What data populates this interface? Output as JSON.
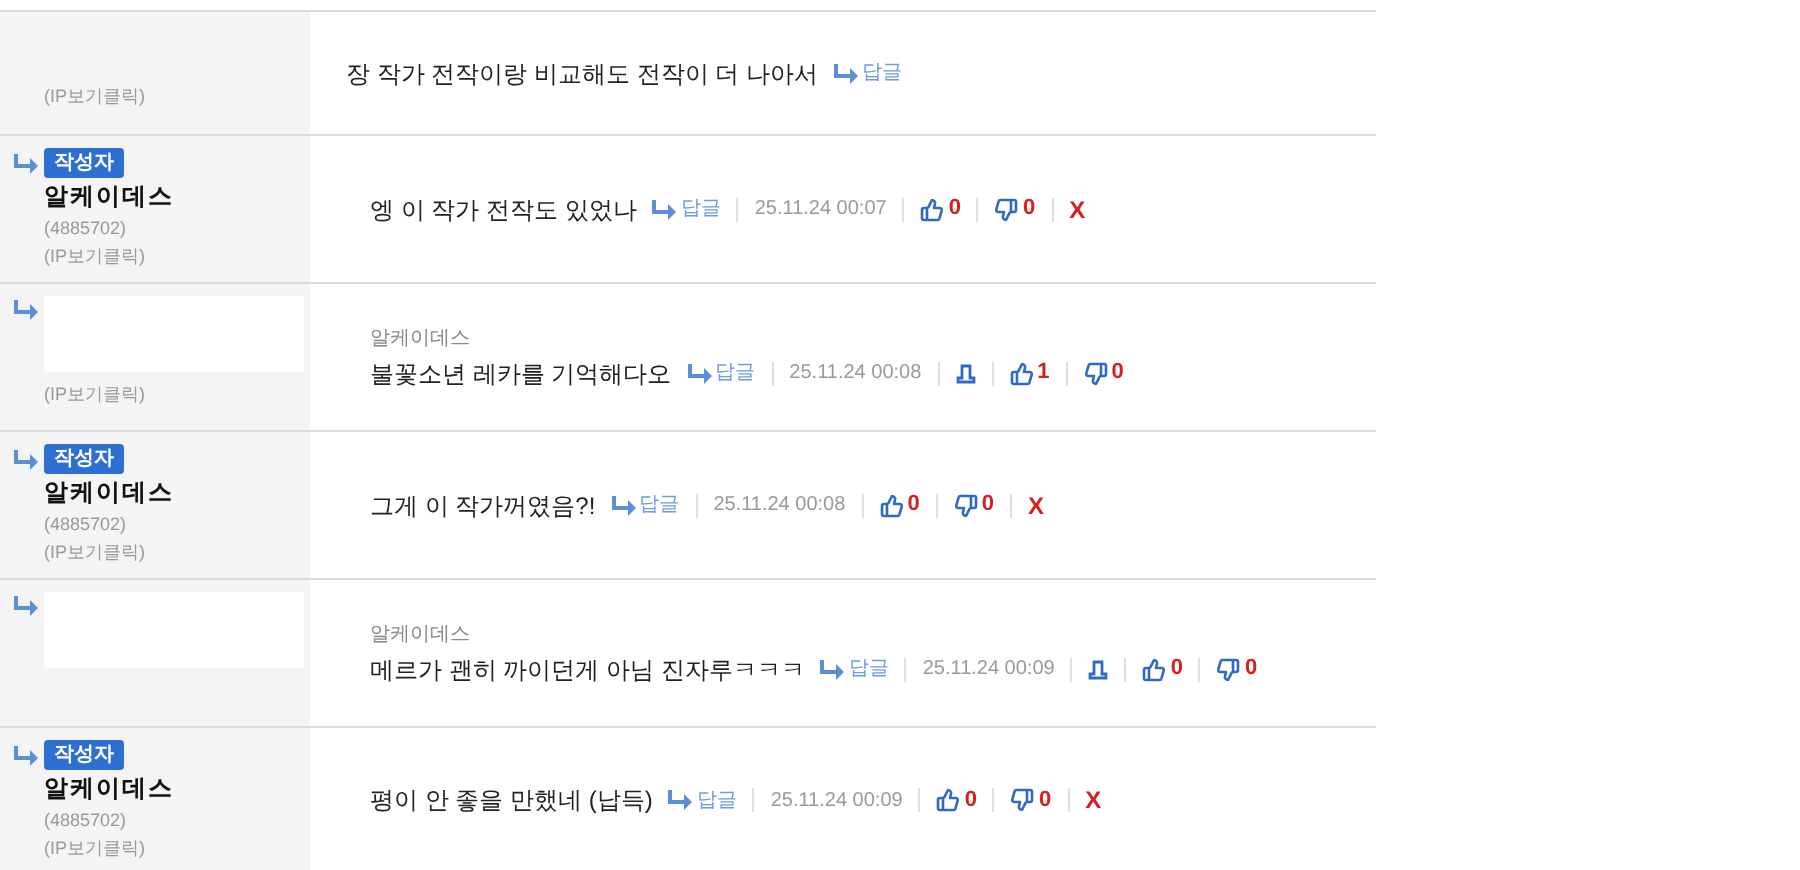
{
  "comments": [
    {
      "kind": "user",
      "ip": "(IP보기클릭)",
      "text": "장 작가 전작이랑 비교해도 전작이 더 나아서",
      "reply": "답글"
    },
    {
      "kind": "author",
      "badge": "작성자",
      "name": "알케이데스",
      "uid": "(4885702)",
      "ip": "(IP보기클릭)",
      "text": "엥 이 작가 전작도 있었나",
      "reply": "답글",
      "date": "25.11.24 00:07",
      "likes": "0",
      "dislikes": "0",
      "delete": "X"
    },
    {
      "kind": "user",
      "ip": "(IP보기클릭)",
      "target": "알케이데스",
      "text": "불꽃소년 레카를 기억해다오",
      "reply": "답글",
      "date": "25.11.24 00:08",
      "report": true,
      "likes": "1",
      "dislikes": "0"
    },
    {
      "kind": "author",
      "badge": "작성자",
      "name": "알케이데스",
      "uid": "(4885702)",
      "ip": "(IP보기클릭)",
      "text": "그게 이 작가꺼였음?!",
      "reply": "답글",
      "date": "25.11.24 00:08",
      "likes": "0",
      "dislikes": "0",
      "delete": "X"
    },
    {
      "kind": "user",
      "target": "알케이데스",
      "text": "메르가 괜히 까이던게 아님 진자루ㅋㅋㅋ",
      "reply": "답글",
      "date": "25.11.24 00:09",
      "report": true,
      "likes": "0",
      "dislikes": "0"
    },
    {
      "kind": "author",
      "badge": "작성자",
      "name": "알케이데스",
      "uid": "(4885702)",
      "ip": "(IP보기클릭)",
      "text": "평이 안 좋을 만했네 (납득)",
      "reply": "답글",
      "date": "25.11.24 00:09",
      "likes": "0",
      "dislikes": "0",
      "delete": "X"
    }
  ]
}
